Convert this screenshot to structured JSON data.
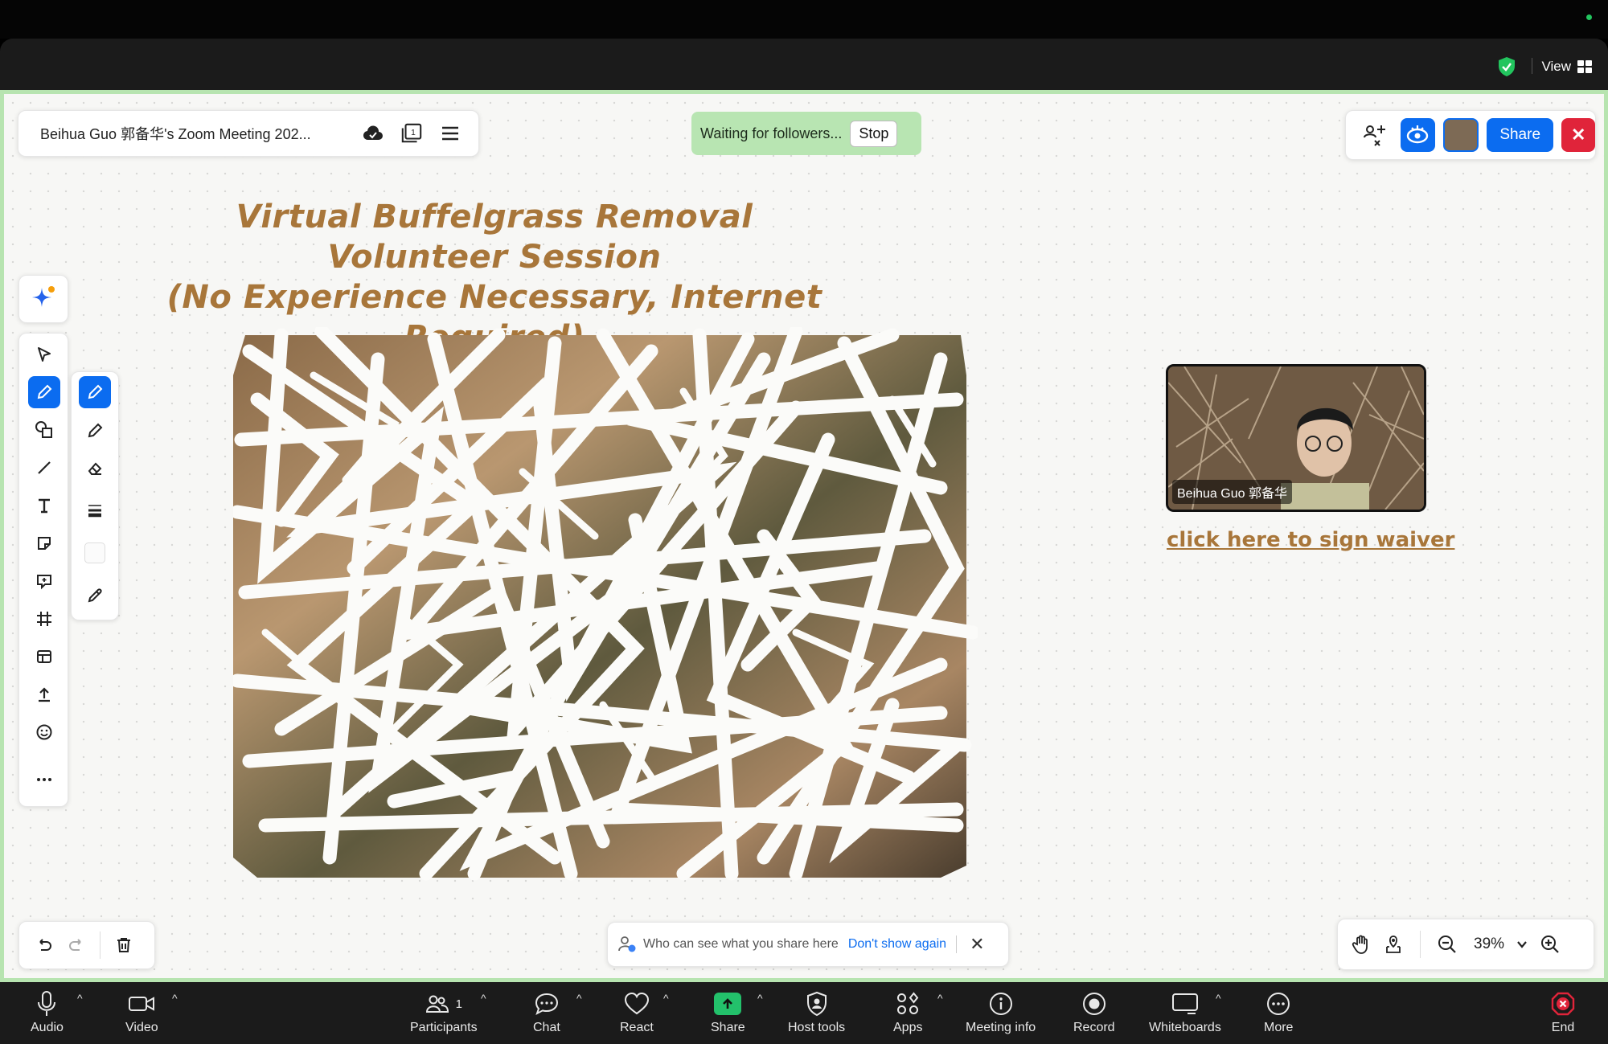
{
  "window": {
    "view_label": "View"
  },
  "header": {
    "meeting_title": "Beihua Guo 郭备华's Zoom Meeting 202...",
    "waiting_text": "Waiting for followers...",
    "stop_label": "Stop",
    "share_label": "Share"
  },
  "board": {
    "heading_line1": "Virtual Buffelgrass Removal Volunteer Session",
    "heading_line2": "(No Experience Necessary, Internet Required)",
    "video_name": "Beihua Guo 郭备华",
    "waiver_link": "click here to sign waiver"
  },
  "tools": [
    {
      "name": "select-tool",
      "icon": "cursor-icon"
    },
    {
      "name": "pen-tool",
      "icon": "pen-icon",
      "active": true
    },
    {
      "name": "shapes-tool",
      "icon": "shapes-icon"
    },
    {
      "name": "line-tool",
      "icon": "line-icon"
    },
    {
      "name": "text-tool",
      "icon": "text-icon"
    },
    {
      "name": "sticky-note-tool",
      "icon": "sticky-note-icon"
    },
    {
      "name": "comment-tool",
      "icon": "comment-icon"
    },
    {
      "name": "frame-tool",
      "icon": "frame-icon"
    },
    {
      "name": "template-tool",
      "icon": "template-icon"
    },
    {
      "name": "upload-tool",
      "icon": "upload-icon"
    },
    {
      "name": "emoji-tool",
      "icon": "emoji-icon"
    },
    {
      "name": "more-tool",
      "icon": "more-icon"
    }
  ],
  "notification": {
    "text": "Who can see what you share here",
    "link": "Don't show again"
  },
  "zoom": {
    "level": "39%"
  },
  "toolbar": {
    "audio": "Audio",
    "video": "Video",
    "participants": "Participants",
    "participant_count": "1",
    "chat": "Chat",
    "react": "React",
    "share": "Share",
    "host_tools": "Host tools",
    "apps": "Apps",
    "meeting_info": "Meeting info",
    "record": "Record",
    "whiteboards": "Whiteboards",
    "more": "More",
    "end": "End"
  },
  "colors": {
    "accent": "#0b6cf0",
    "heading": "#a8763a",
    "waiting_bg": "#b8e5b2",
    "end_red": "#e0243a"
  }
}
